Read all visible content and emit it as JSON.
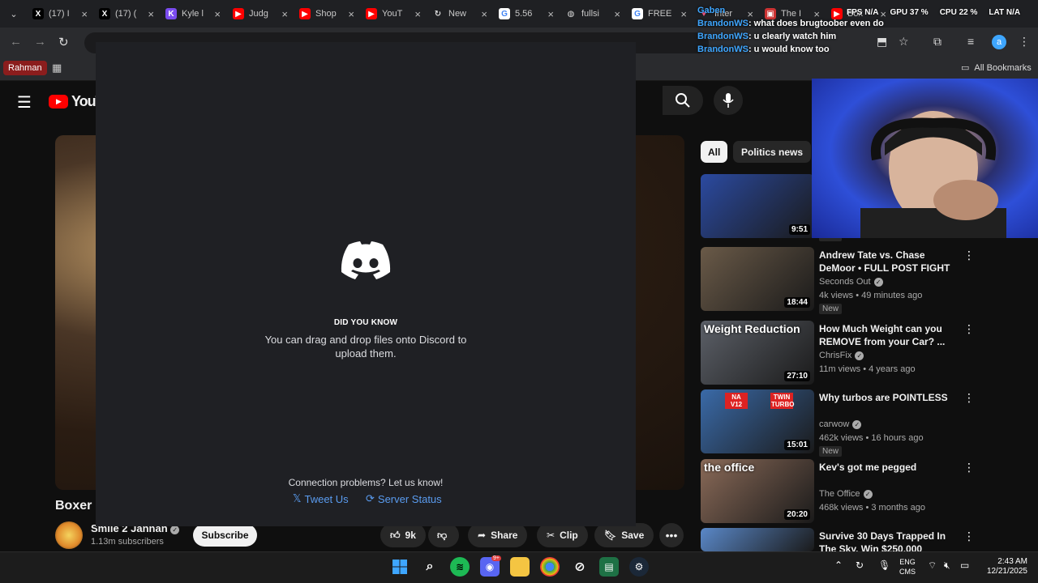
{
  "browser": {
    "tabs": [
      {
        "label": "(17) I",
        "icon": "x-logo-icon"
      },
      {
        "label": "(17) (",
        "icon": "x-logo-icon"
      },
      {
        "label": "Kyle l",
        "icon": "kick-icon"
      },
      {
        "label": "Judg",
        "icon": "youtube-icon"
      },
      {
        "label": "Shop",
        "icon": "youtube-icon"
      },
      {
        "label": "YouT",
        "icon": "youtube-icon"
      },
      {
        "label": "New",
        "icon": "refresh-icon"
      },
      {
        "label": "5.56",
        "icon": "google-icon"
      },
      {
        "label": "fullsi",
        "icon": "globe-icon"
      },
      {
        "label": "FREE",
        "icon": "google-icon"
      },
      {
        "label": "Inter",
        "icon": "heart-icon"
      },
      {
        "label": "The I",
        "icon": "image-icon"
      },
      {
        "label": "Box",
        "icon": "youtube-icon"
      }
    ],
    "bookmarks": {
      "profile_label": "Rahman",
      "all_label": "All Bookmarks"
    }
  },
  "overlay": {
    "perf": {
      "fps": "FPS N/A",
      "gpu": "GPU 37 %",
      "cpu": "CPU 22 %",
      "lat": "LAT N/A"
    },
    "chat": [
      {
        "user": "Gaben",
        "text": ""
      },
      {
        "user": "BrandonWS",
        "text": ": what does brugtoober even do"
      },
      {
        "user": "BrandonWS",
        "text": ": u clearly watch him"
      },
      {
        "user": "BrandonWS",
        "text": ": u would know too"
      }
    ]
  },
  "youtube": {
    "logo_text": "YouTube",
    "video": {
      "title": "Boxer (",
      "channel": "Smile 2 Jannah",
      "subscribers": "1.13m subscribers",
      "subscribe_label": "Subscribe",
      "likes": "9k",
      "share_label": "Share",
      "clip_label": "Clip",
      "save_label": "Save"
    },
    "chips": {
      "all": "All",
      "politics": "Politics news"
    },
    "recommendations": [
      {
        "title": "",
        "channel": "",
        "meta": "",
        "badge": "New",
        "duration": "9:51",
        "thumb": "#2b4aa0"
      },
      {
        "title": "Andrew Tate vs. Chase DeMoor • FULL POST FIGHT PRESS ...",
        "channel": "Seconds Out",
        "meta": "4k views • 49 minutes ago",
        "badge": "New",
        "duration": "18:44",
        "thumb": "#6a5a48"
      },
      {
        "title": "How Much Weight can you REMOVE from your Car? ...",
        "channel": "ChrisFix",
        "meta": "11m views • 4 years ago",
        "badge": "",
        "duration": "27:10",
        "thumb": "#5c6068",
        "thumb_text": "Weight Reduction"
      },
      {
        "title": "Why turbos are POINTLESS",
        "channel": "carwow",
        "meta": "462k views • 16 hours ago",
        "badge": "New",
        "duration": "15:01",
        "thumb": "#3a6aa8",
        "thumb_tags": [
          "NA V12",
          "TWIN TURBO"
        ]
      },
      {
        "title": "Kev's got me pegged",
        "channel": "The Office",
        "meta": "468k views • 3 months ago",
        "badge": "",
        "duration": "20:20",
        "thumb": "#8a6a58",
        "thumb_text": "the office"
      },
      {
        "title": "Survive 30 Days Trapped In The Sky, Win $250,000",
        "channel": "",
        "meta": "",
        "badge": "",
        "duration": "",
        "thumb": "#5a88c8"
      }
    ]
  },
  "discord": {
    "did_you_know": "DID YOU KNOW",
    "tip": "You can drag and drop files onto Discord to upload them.",
    "connection": "Connection problems? Let us know!",
    "tweet": "Tweet Us",
    "status": "Server Status"
  },
  "taskbar": {
    "lang_line1": "ENG",
    "lang_line2": "CMS",
    "time": "2:43 AM",
    "date": "12/21/2025",
    "discord_badge": "9+"
  },
  "colors": {
    "youtube_red": "#ff0000",
    "link_blue": "#5a9cf0",
    "discord_bg": "#1f2024",
    "yt_bg": "#0f0f0f"
  }
}
